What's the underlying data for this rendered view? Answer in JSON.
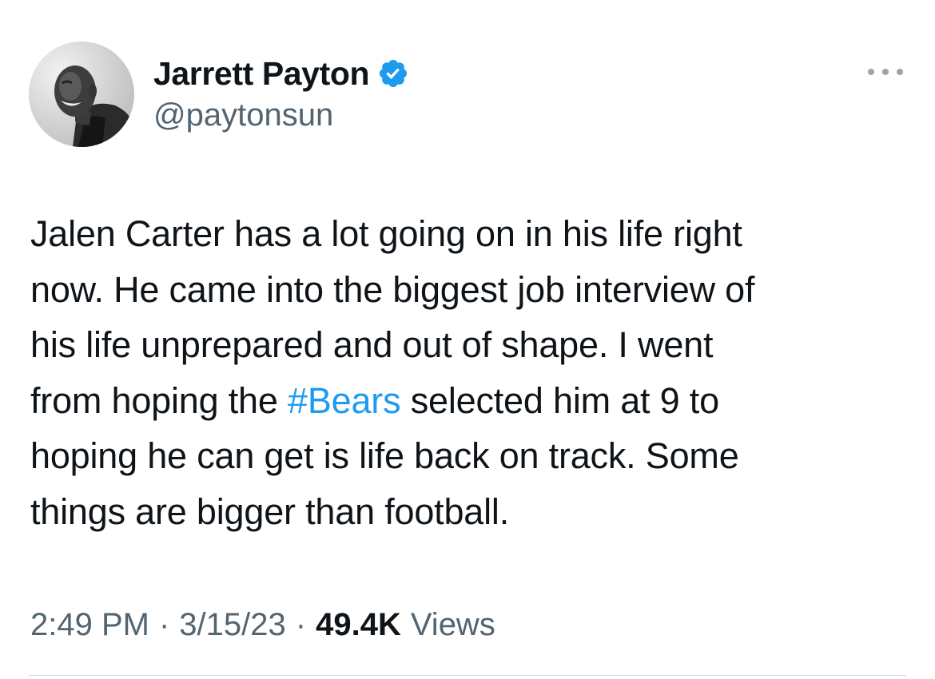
{
  "author": {
    "display_name": "Jarrett Payton",
    "handle": "@paytonsun",
    "verified": true,
    "verified_color": "#1d9bf0"
  },
  "tweet": {
    "line1": "Jalen Carter has a lot going on in his life right",
    "line2": "now. He came into the biggest job interview of",
    "line3": "his life unprepared and out of shape. I went",
    "line4_before": "from hoping the ",
    "hashtag": "#Bears",
    "line4_after": " selected him at 9 to",
    "line5": "hoping he can get is life back on track. Some",
    "line6": "things are bigger than football."
  },
  "meta": {
    "time": "2:49 PM",
    "separator": "·",
    "date": "3/15/23",
    "views_count": "49.4K",
    "views_label": "Views"
  },
  "colors": {
    "text_primary": "#0f1419",
    "text_secondary": "#536471",
    "link": "#1d9bf0",
    "divider": "#cfd9de"
  },
  "icons": {
    "avatar": "profile-photo",
    "verified": "verified-badge-icon",
    "more": "more-options-icon"
  }
}
